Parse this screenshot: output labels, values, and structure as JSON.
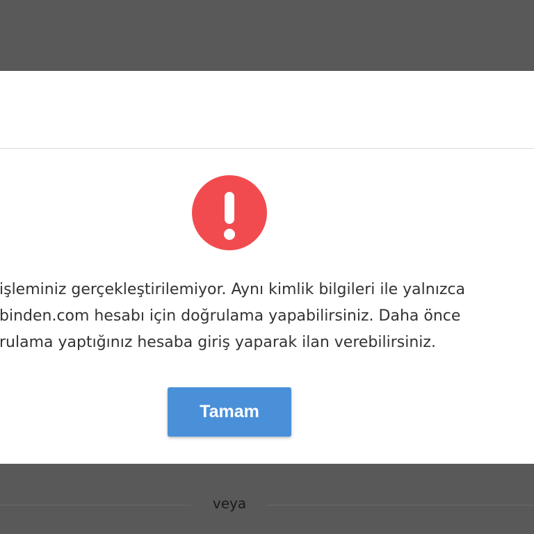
{
  "dialog": {
    "message_lines": [
      "işleminiz gerçekleştirilemiyor. Aynı kimlik bilgileri ile yalnızca",
      "binden.com hesabı için doğrulama yapabilirsiniz. Daha önce",
      "rulama yaptığınız hesaba giriş yaparak ilan verebilirsiniz."
    ],
    "ok_label": "Tamam",
    "icon": "alert-exclamation-icon"
  },
  "background": {
    "or_label": "veya"
  },
  "colors": {
    "overlay": "#595959",
    "alert_red": "#f24b4f",
    "button_blue": "#4a90d9",
    "text": "#333333"
  }
}
